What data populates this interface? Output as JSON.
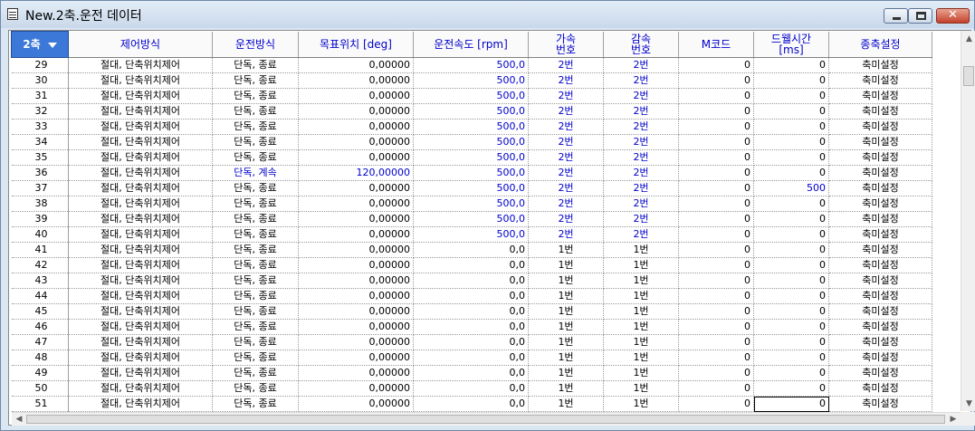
{
  "window": {
    "title": "New.2축.운전 데이터",
    "close_label": "✕"
  },
  "grid": {
    "axis_header": "2축",
    "columns": [
      {
        "key": "mode",
        "label": "제어방식",
        "lines": [
          "제어방식"
        ]
      },
      {
        "key": "op",
        "label": "운전방식",
        "lines": [
          "운전방식"
        ]
      },
      {
        "key": "pos",
        "label": "목표위치 [deg]",
        "lines": [
          "목표위치 [deg]"
        ]
      },
      {
        "key": "speed",
        "label": "운전속도 [rpm]",
        "lines": [
          "운전속도 [rpm]"
        ]
      },
      {
        "key": "acc",
        "label": "가속 번호",
        "lines": [
          "가속",
          "번호"
        ]
      },
      {
        "key": "dec",
        "label": "감속 번호",
        "lines": [
          "감속",
          "번호"
        ]
      },
      {
        "key": "m",
        "label": "M코드",
        "lines": [
          "M코드"
        ]
      },
      {
        "key": "dwell",
        "label": "드웰시간 [ms]",
        "lines": [
          "드웰시간",
          "[ms]"
        ]
      },
      {
        "key": "axis",
        "label": "종축설정",
        "lines": [
          "종축설정"
        ]
      }
    ],
    "rows": [
      {
        "no": "29",
        "mode": "절대, 단축위치제어",
        "op": "단독, 종료",
        "pos": "0,00000",
        "speed": "500,0",
        "acc": "2번",
        "dec": "2번",
        "m": "0",
        "dwell": "0",
        "axis": "축미설정"
      },
      {
        "no": "30",
        "mode": "절대, 단축위치제어",
        "op": "단독, 종료",
        "pos": "0,00000",
        "speed": "500,0",
        "acc": "2번",
        "dec": "2번",
        "m": "0",
        "dwell": "0",
        "axis": "축미설정"
      },
      {
        "no": "31",
        "mode": "절대, 단축위치제어",
        "op": "단독, 종료",
        "pos": "0,00000",
        "speed": "500,0",
        "acc": "2번",
        "dec": "2번",
        "m": "0",
        "dwell": "0",
        "axis": "축미설정"
      },
      {
        "no": "32",
        "mode": "절대, 단축위치제어",
        "op": "단독, 종료",
        "pos": "0,00000",
        "speed": "500,0",
        "acc": "2번",
        "dec": "2번",
        "m": "0",
        "dwell": "0",
        "axis": "축미설정"
      },
      {
        "no": "33",
        "mode": "절대, 단축위치제어",
        "op": "단독, 종료",
        "pos": "0,00000",
        "speed": "500,0",
        "acc": "2번",
        "dec": "2번",
        "m": "0",
        "dwell": "0",
        "axis": "축미설정"
      },
      {
        "no": "34",
        "mode": "절대, 단축위치제어",
        "op": "단독, 종료",
        "pos": "0,00000",
        "speed": "500,0",
        "acc": "2번",
        "dec": "2번",
        "m": "0",
        "dwell": "0",
        "axis": "축미설정"
      },
      {
        "no": "35",
        "mode": "절대, 단축위치제어",
        "op": "단독, 종료",
        "pos": "0,00000",
        "speed": "500,0",
        "acc": "2번",
        "dec": "2번",
        "m": "0",
        "dwell": "0",
        "axis": "축미설정"
      },
      {
        "no": "36",
        "mode": "절대, 단축위치제어",
        "op": "단독, 계속",
        "pos": "120,00000",
        "speed": "500,0",
        "acc": "2번",
        "dec": "2번",
        "m": "0",
        "dwell": "0",
        "axis": "축미설정",
        "blue": [
          "op",
          "pos",
          "speed",
          "acc",
          "dec"
        ]
      },
      {
        "no": "37",
        "mode": "절대, 단축위치제어",
        "op": "단독, 종료",
        "pos": "0,00000",
        "speed": "500,0",
        "acc": "2번",
        "dec": "2번",
        "m": "0",
        "dwell": "500",
        "axis": "축미설정",
        "blue": [
          "speed",
          "acc",
          "dec",
          "dwell"
        ]
      },
      {
        "no": "38",
        "mode": "절대, 단축위치제어",
        "op": "단독, 종료",
        "pos": "0,00000",
        "speed": "500,0",
        "acc": "2번",
        "dec": "2번",
        "m": "0",
        "dwell": "0",
        "axis": "축미설정"
      },
      {
        "no": "39",
        "mode": "절대, 단축위치제어",
        "op": "단독, 종료",
        "pos": "0,00000",
        "speed": "500,0",
        "acc": "2번",
        "dec": "2번",
        "m": "0",
        "dwell": "0",
        "axis": "축미설정"
      },
      {
        "no": "40",
        "mode": "절대, 단축위치제어",
        "op": "단독, 종료",
        "pos": "0,00000",
        "speed": "500,0",
        "acc": "2번",
        "dec": "2번",
        "m": "0",
        "dwell": "0",
        "axis": "축미설정"
      },
      {
        "no": "41",
        "mode": "절대, 단축위치제어",
        "op": "단독, 종료",
        "pos": "0,00000",
        "speed": "0,0",
        "acc": "1번",
        "dec": "1번",
        "m": "0",
        "dwell": "0",
        "axis": "축미설정"
      },
      {
        "no": "42",
        "mode": "절대, 단축위치제어",
        "op": "단독, 종료",
        "pos": "0,00000",
        "speed": "0,0",
        "acc": "1번",
        "dec": "1번",
        "m": "0",
        "dwell": "0",
        "axis": "축미설정"
      },
      {
        "no": "43",
        "mode": "절대, 단축위치제어",
        "op": "단독, 종료",
        "pos": "0,00000",
        "speed": "0,0",
        "acc": "1번",
        "dec": "1번",
        "m": "0",
        "dwell": "0",
        "axis": "축미설정"
      },
      {
        "no": "44",
        "mode": "절대, 단축위치제어",
        "op": "단독, 종료",
        "pos": "0,00000",
        "speed": "0,0",
        "acc": "1번",
        "dec": "1번",
        "m": "0",
        "dwell": "0",
        "axis": "축미설정"
      },
      {
        "no": "45",
        "mode": "절대, 단축위치제어",
        "op": "단독, 종료",
        "pos": "0,00000",
        "speed": "0,0",
        "acc": "1번",
        "dec": "1번",
        "m": "0",
        "dwell": "0",
        "axis": "축미설정"
      },
      {
        "no": "46",
        "mode": "절대, 단축위치제어",
        "op": "단독, 종료",
        "pos": "0,00000",
        "speed": "0,0",
        "acc": "1번",
        "dec": "1번",
        "m": "0",
        "dwell": "0",
        "axis": "축미설정"
      },
      {
        "no": "47",
        "mode": "절대, 단축위치제어",
        "op": "단독, 종료",
        "pos": "0,00000",
        "speed": "0,0",
        "acc": "1번",
        "dec": "1번",
        "m": "0",
        "dwell": "0",
        "axis": "축미설정"
      },
      {
        "no": "48",
        "mode": "절대, 단축위치제어",
        "op": "단독, 종료",
        "pos": "0,00000",
        "speed": "0,0",
        "acc": "1번",
        "dec": "1번",
        "m": "0",
        "dwell": "0",
        "axis": "축미설정"
      },
      {
        "no": "49",
        "mode": "절대, 단축위치제어",
        "op": "단독, 종료",
        "pos": "0,00000",
        "speed": "0,0",
        "acc": "1번",
        "dec": "1번",
        "m": "0",
        "dwell": "0",
        "axis": "축미설정"
      },
      {
        "no": "50",
        "mode": "절대, 단축위치제어",
        "op": "단독, 종료",
        "pos": "0,00000",
        "speed": "0,0",
        "acc": "1번",
        "dec": "1번",
        "m": "0",
        "dwell": "0",
        "axis": "축미설정"
      },
      {
        "no": "51",
        "mode": "절대, 단축위치제어",
        "op": "단독, 종료",
        "pos": "0,00000",
        "speed": "0,0",
        "acc": "1번",
        "dec": "1번",
        "m": "0",
        "dwell": "0",
        "axis": "축미설정",
        "selected": "dwell"
      }
    ],
    "blue_rows": [
      "29",
      "30",
      "31",
      "32",
      "33",
      "34",
      "35",
      "38",
      "39",
      "40"
    ],
    "blue_fields": [
      "speed",
      "acc",
      "dec"
    ]
  },
  "icons": {
    "window_icon": "document-list-icon",
    "minimize": "minimize-icon",
    "maximize": "maximize-icon",
    "close": "close-icon",
    "sort": "sort-down-icon",
    "scroll_up": "scroll-up-arrow-icon",
    "scroll_down": "scroll-down-arrow-icon",
    "scroll_left": "scroll-left-arrow-icon",
    "scroll_right": "scroll-right-arrow-icon"
  },
  "colors": {
    "header_text": "#0000cc",
    "value_blue": "#0000cc",
    "selected_header_bg": "#3b78d8",
    "close_button": "#c4402a"
  }
}
